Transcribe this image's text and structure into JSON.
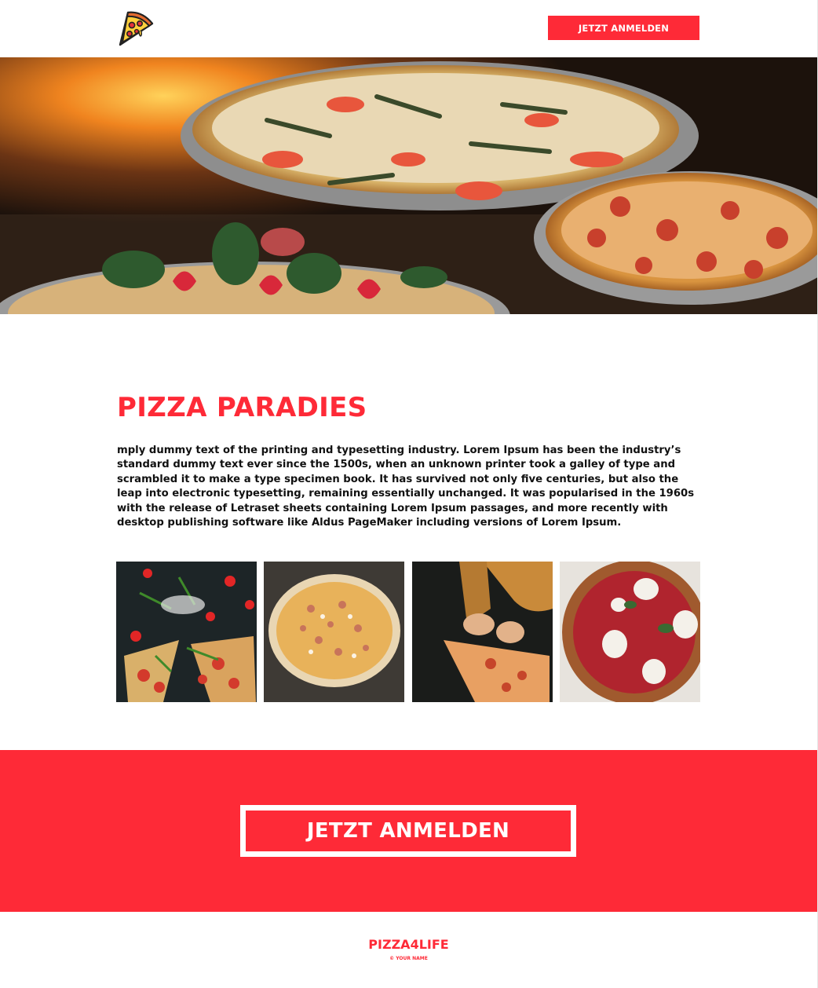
{
  "header": {
    "logo_icon": "pizza-slice-icon",
    "cta_label": "JETZT ANMELDEN"
  },
  "hero": {
    "image": "pizzas-on-stands-photo"
  },
  "intro": {
    "title": "PIZZA PARADIES",
    "text": "mply dummy text of the printing and typesetting industry. Lorem Ipsum has been the industry’s standard dummy text ever since the 1500s, when an unknown printer took a galley of type and scrambled it to make a type specimen book. It has survived not only five centuries, but also the leap into electronic typesetting, remaining essentially unchanged. It was popularised in the 1960s with the release of Letraset sheets containing Lorem Ipsum passages, and more recently with desktop publishing software like Aldus PageMaker including versions of Lorem Ipsum."
  },
  "gallery": {
    "images": [
      "pizza-slices-arugula-photo",
      "raw-pizza-photo",
      "hands-pizza-photo",
      "margherita-pizza-photo"
    ]
  },
  "cta": {
    "label": "JETZT ANMELDEN"
  },
  "footer": {
    "brand": "PIZZA4LIFE",
    "copyright": "© YOUR NAME"
  },
  "colors": {
    "accent": "#fe2a37",
    "text": "#111111",
    "background": "#ffffff"
  }
}
